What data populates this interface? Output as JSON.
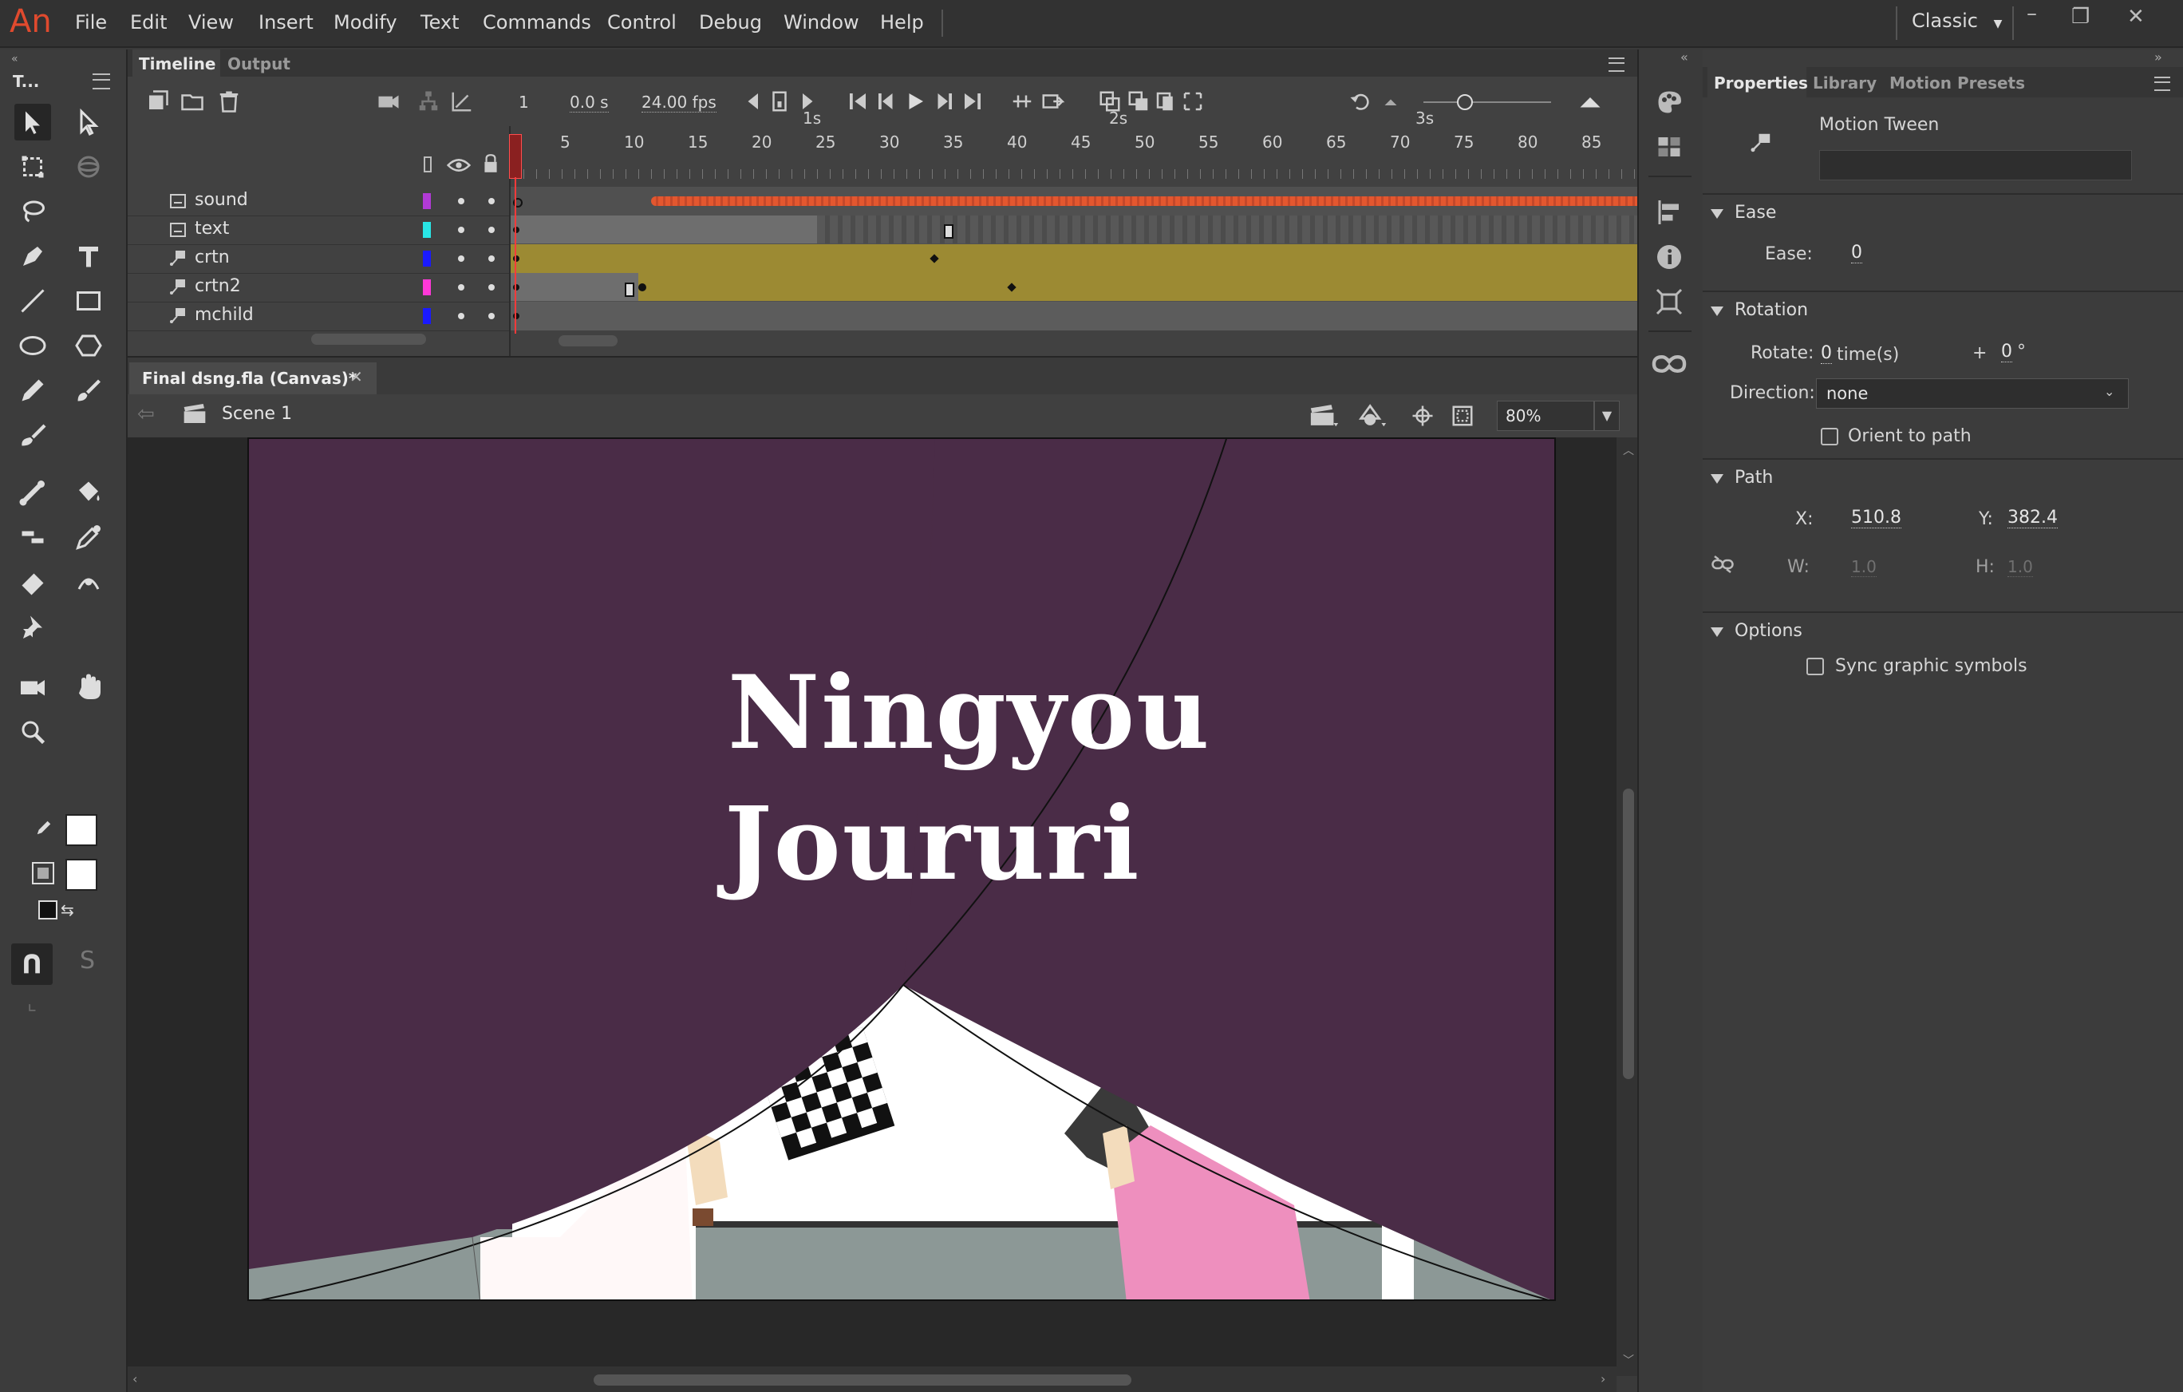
{
  "app": {
    "logo": "An",
    "workspace": "Classic"
  },
  "menu": [
    "File",
    "Edit",
    "View",
    "Insert",
    "Modify",
    "Text",
    "Commands",
    "Control",
    "Debug",
    "Window",
    "Help"
  ],
  "tools_panel": {
    "title": "T..."
  },
  "timeline": {
    "tabs": [
      "Timeline",
      "Output"
    ],
    "current_frame": "1",
    "elapsed": "0.0 s",
    "fps": "24.00 fps",
    "seconds": [
      "1s",
      "2s",
      "3s"
    ],
    "ruler": [
      "1",
      "5",
      "10",
      "15",
      "20",
      "25",
      "30",
      "35",
      "40",
      "45",
      "50",
      "55",
      "60",
      "65",
      "70",
      "75",
      "80",
      "85"
    ],
    "layers": [
      {
        "name": "sound",
        "color": "#b13ad6"
      },
      {
        "name": "text",
        "color": "#29e6e6"
      },
      {
        "name": "crtn",
        "color": "#1a1aff"
      },
      {
        "name": "crtn2",
        "color": "#ff38d8"
      },
      {
        "name": "mchild",
        "color": "#1a1aff"
      }
    ]
  },
  "document": {
    "tab": "Final dsng.fla (Canvas)*",
    "scene": "Scene 1",
    "zoom": "80%"
  },
  "stage": {
    "title_line1": "Ningyou",
    "title_line2": "Joururi",
    "background": "#4a2c47"
  },
  "properties": {
    "tabs": [
      "Properties",
      "Library",
      "Motion Presets"
    ],
    "object_type": "Motion Tween",
    "ease": {
      "section": "Ease",
      "label": "Ease:",
      "value": "0"
    },
    "rotation": {
      "section": "Rotation",
      "rotate_label": "Rotate:",
      "rotate_value": "0",
      "times": "time(s)",
      "plus": "+",
      "degrees": "0",
      "degree_sign": "°",
      "direction_label": "Direction:",
      "direction_value": "none",
      "orient_label": "Orient to path"
    },
    "path": {
      "section": "Path",
      "x_label": "X:",
      "x_value": "510.8",
      "y_label": "Y:",
      "y_value": "382.4",
      "w_label": "W:",
      "w_value": "1.0",
      "h_label": "H:",
      "h_value": "1.0"
    },
    "options": {
      "section": "Options",
      "sync_label": "Sync graphic symbols"
    }
  }
}
